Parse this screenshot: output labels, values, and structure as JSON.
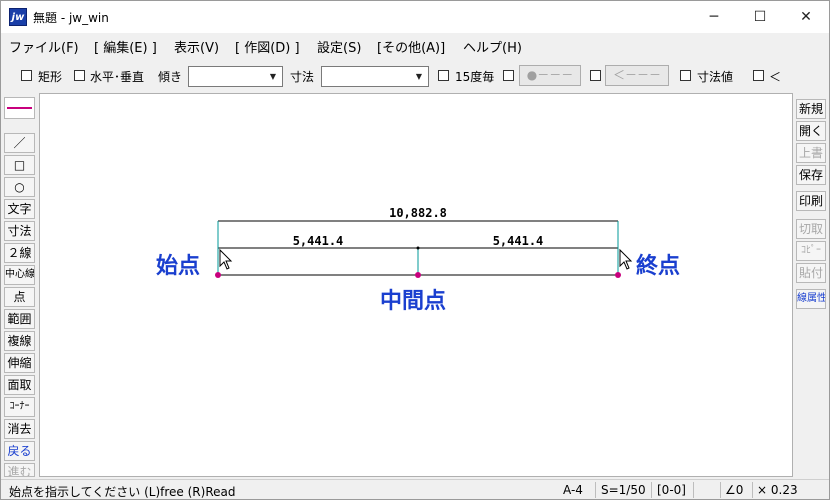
{
  "window": {
    "app_icon": "jw",
    "title": "無題 - jw_win",
    "controls": {
      "minimize": "─",
      "maximize": "☐",
      "close": "✕"
    }
  },
  "menu": [
    "ファイル(F)",
    "[ 編集(E) ]",
    "表示(V)",
    "[ 作図(D) ]",
    "設定(S)",
    "[その他(A)]",
    "ヘルプ(H)"
  ],
  "toolbar": {
    "rect": "矩形",
    "hv": "水平･垂直",
    "tilt_label": "傾き",
    "dim_label": "寸法",
    "deg15": "15度毎",
    "btn_dot": "●－－－",
    "btn_arrow": "＜－－－",
    "dim_value": "寸法値",
    "lt": "＜"
  },
  "left_tools": [
    "／",
    "□",
    "○",
    "文字",
    "寸法",
    "２線",
    "中心線",
    "点",
    "範囲",
    "複線",
    "伸縮",
    "面取",
    "ｺｰﾅｰ",
    "消去",
    "戻る",
    "進む"
  ],
  "right_tools": [
    {
      "label": "新規",
      "enabled": true
    },
    {
      "label": "開く",
      "enabled": true
    },
    {
      "label": "上書",
      "enabled": false
    },
    {
      "label": "保存",
      "enabled": true
    },
    {
      "label": "印刷",
      "enabled": true
    },
    {
      "label": "切取",
      "enabled": false
    },
    {
      "label": "ｺﾋﾟｰ",
      "enabled": false
    },
    {
      "label": "貼付",
      "enabled": false
    },
    {
      "label": "線属性",
      "enabled": true
    }
  ],
  "drawing": {
    "total_dim": "10,882.8",
    "half_dim_left": "5,441.4",
    "half_dim_right": "5,441.4",
    "label_start": "始点",
    "label_mid": "中間点",
    "label_end": "終点"
  },
  "status": {
    "message": "始点を指示してください (L)free (R)Read",
    "paper": "A-4",
    "scale": "S=1/50",
    "layer": "[0-0]",
    "angle": "∠0",
    "ratio": "× 0.23"
  },
  "colors": {
    "accent_blue": "#1a3fcf",
    "line": "#000000",
    "dim_tick": "#009999",
    "point": "#c8007d",
    "disabled": "#a8a8a8"
  }
}
